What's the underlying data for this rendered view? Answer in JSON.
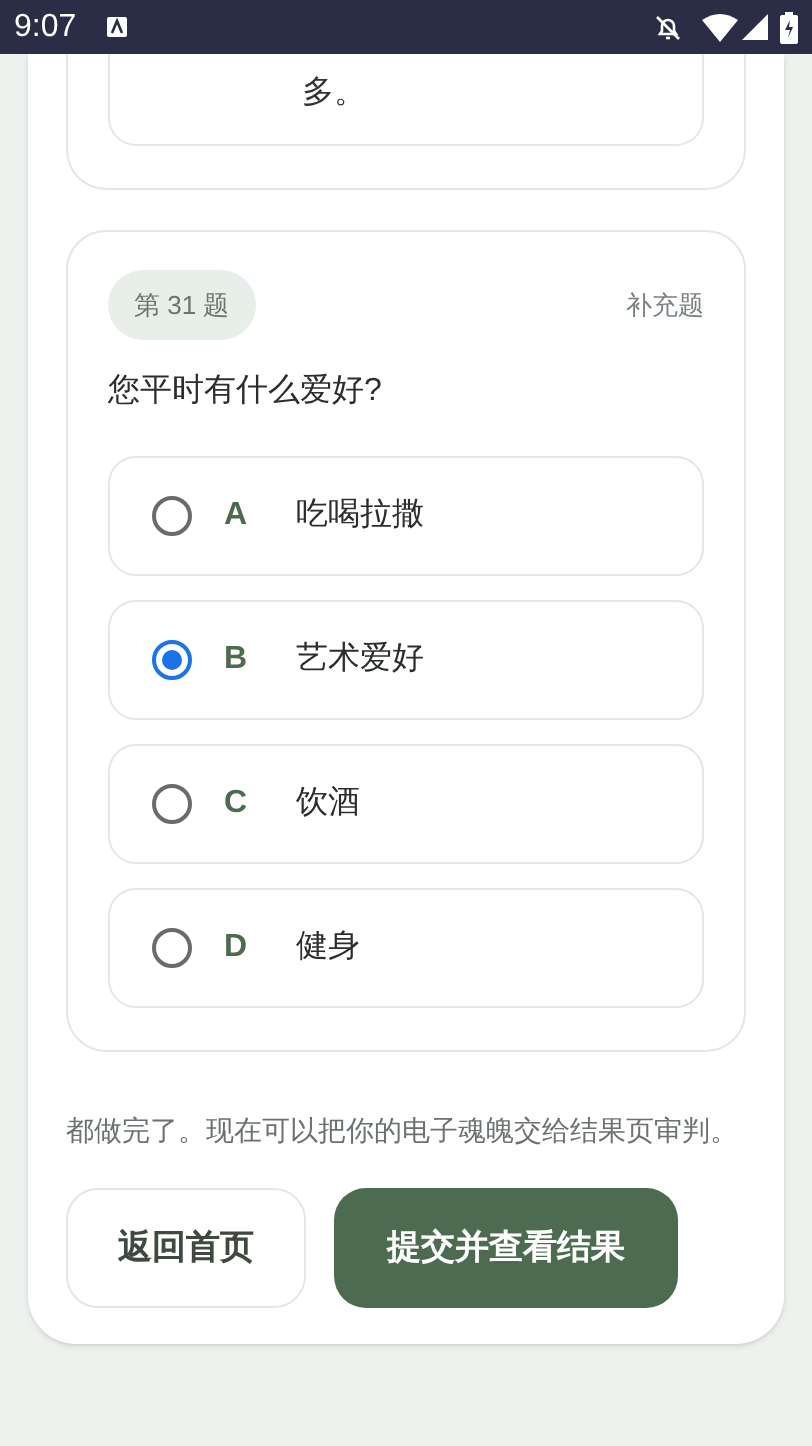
{
  "status_bar": {
    "time": "9:07"
  },
  "previous_question": {
    "answer_tail": "多。"
  },
  "question": {
    "number": "第 31 题",
    "type": "补充题",
    "text": "您平时有什么爱好?",
    "options": [
      {
        "letter": "A",
        "label": "吃喝拉撒",
        "selected": false
      },
      {
        "letter": "B",
        "label": "艺术爱好",
        "selected": true
      },
      {
        "letter": "C",
        "label": "饮酒",
        "selected": false
      },
      {
        "letter": "D",
        "label": "健身",
        "selected": false
      }
    ]
  },
  "completion_note": "都做完了。现在可以把你的电子魂魄交给结果页审判。",
  "buttons": {
    "home": "返回首页",
    "submit": "提交并查看结果"
  }
}
